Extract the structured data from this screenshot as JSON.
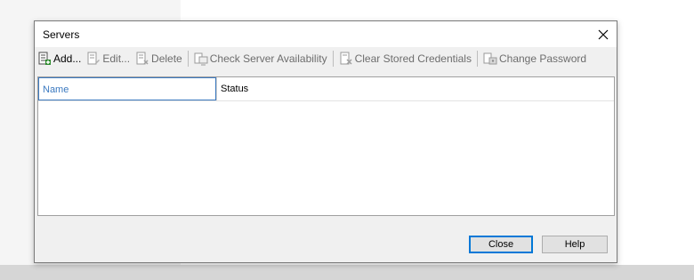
{
  "dialog": {
    "title": "Servers",
    "close_icon": "close-icon"
  },
  "toolbar": {
    "add_label": "Add...",
    "edit_label": "Edit...",
    "delete_label": "Delete",
    "check_label": "Check Server Availability",
    "clear_label": "Clear Stored Credentials",
    "change_label": "Change Password"
  },
  "grid": {
    "columns": [
      "Name",
      "Status"
    ]
  },
  "buttons": {
    "close_label": "Close",
    "help_label": "Help"
  },
  "colors": {
    "accent": "#0078d7",
    "header_selected": "#3b79c0"
  }
}
